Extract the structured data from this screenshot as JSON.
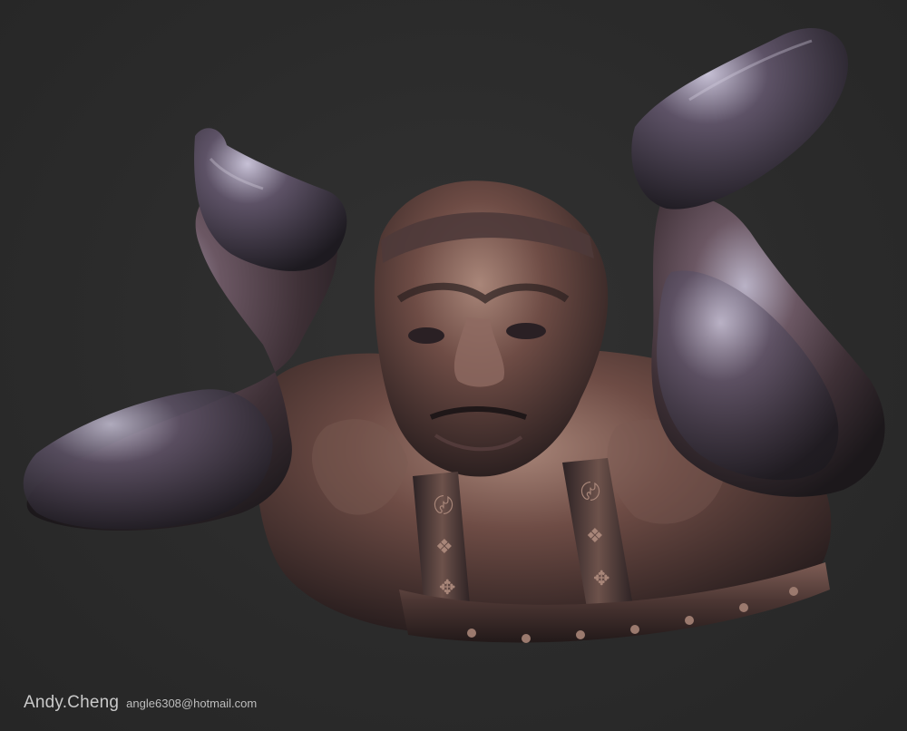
{
  "credit": {
    "name": "Andy.Cheng",
    "email": "angle6308@hotmail.com"
  },
  "render": {
    "subject": "sculpted-bust",
    "colors": {
      "background": "#2b2b2b",
      "metal_highlight": "#c9c3d6",
      "metal_mid": "#5c4a55",
      "metal_shadow": "#1e1a1e",
      "copper": "#8a5a45"
    }
  }
}
